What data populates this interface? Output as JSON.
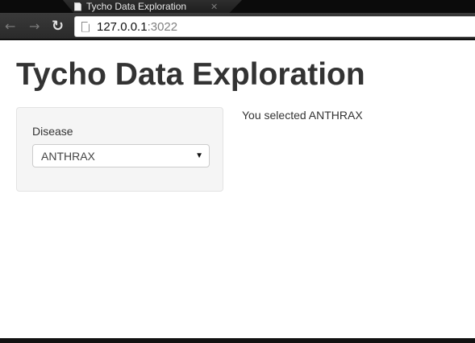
{
  "browser": {
    "tab_title": "Tycho Data Exploration",
    "tab_close": "✕",
    "back_icon": "arrow-left-icon",
    "forward_icon": "arrow-right-icon",
    "reload_icon": "reload-icon",
    "url_host": "127.0.0.1",
    "url_port": ":3022"
  },
  "app": {
    "title": "Tycho Data Exploration",
    "sidebar": {
      "disease_label": "Disease",
      "disease_selected": "ANTHRAX"
    },
    "output_text": "You selected ANTHRAX"
  }
}
